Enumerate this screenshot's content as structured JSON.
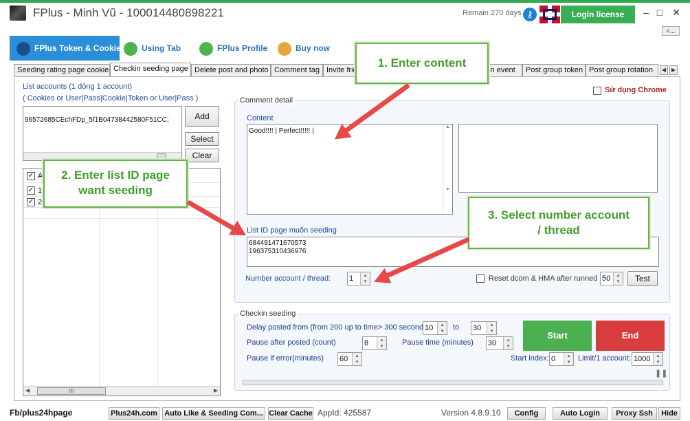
{
  "titlebar": {
    "title": "FPlus - Minh Vũ - 100014480898221",
    "remain": "Remain 270 days",
    "login_label": "Login license",
    "minimize": "–",
    "maximize": "□",
    "close": "✕"
  },
  "collapse_label": "<...",
  "main_tabs": [
    {
      "label": "FPlus Token & Cookie",
      "icon": "fplus-token-icon"
    },
    {
      "label": "Using Tab",
      "icon": "link-icon"
    },
    {
      "label": "FPlus Profile",
      "icon": "users-icon"
    },
    {
      "label": "Buy now",
      "icon": "refresh-icon"
    }
  ],
  "sub_tabs": [
    "Seeding rating page cookie",
    "Checkin seeding page",
    "Delete post and photo",
    "Comment tag",
    "Invite frie",
    "oin event",
    "Post group token",
    "Post group rotation"
  ],
  "left": {
    "list_label": "List accounts (1 dòng 1 account)",
    "list_hint": "( Cookies or User|Pass|Cookie|Token or User|Pass )",
    "account_value": "96572685CEchFDp_5f1B04738442580F51CC;",
    "add_label": "Add",
    "select_label": "Select",
    "clear_label": "Clear",
    "rows": [
      "A",
      "1",
      "2"
    ],
    "scroll_thumb": "III"
  },
  "comment": {
    "group_title": "Comment detail",
    "use_chrome_label": "Sử dụng Chrome",
    "content_label": "Content",
    "content_value": "Good!!!! | Perfect!!!!! |",
    "list_id_label": "List ID page muốn seeding",
    "list_ids": [
      "684491471670573",
      "196375310436976"
    ],
    "number_account_label": "Number account / thread:",
    "number_account_value": "1",
    "reset_label": "Reset dcom & HMA after runned",
    "reset_value": "50",
    "test_label": "Test"
  },
  "checkin": {
    "group_title": "Checkin seeding",
    "delay_label": "Delay posted from (from 200 up to time> 300 seconds)",
    "delay_from": "10",
    "to_label": "to",
    "delay_to": "30",
    "pause_after_label": "Pause after posted (count)",
    "pause_after_value": "8",
    "pause_time_label": "Pause time (minutes)",
    "pause_time_value": "30",
    "pause_error_label": "Pause if error(minutes)",
    "pause_error_value": "60",
    "start_index_label": "Start index:",
    "start_index_value": "0",
    "limit_label": "Limit/1 account:",
    "limit_value": "1000",
    "start_label": "Start",
    "end_label": "End"
  },
  "callouts": {
    "c1": "1. Enter content",
    "c2_line1": "2. Enter list ID page",
    "c2_line2": "want seeding",
    "c3_line1": "3. Select number account",
    "c3_line2": "/ thread"
  },
  "status": {
    "page_label": "Fb/plus24hpage",
    "plus24h": "Plus24h.com",
    "auto_like": "Auto Like & Seeding Com...",
    "clear_cache": "Clear Cache",
    "appid": "AppId: 425587",
    "version": "Version 4.8.9.10",
    "config": "Config",
    "auto_login": "Auto Login",
    "proxy": "Proxy Ssh",
    "hide": "Hide"
  },
  "colors": {
    "accent_green": "#3aae55",
    "start_green": "#4caf50",
    "end_red": "#d93c3c",
    "tab_blue": "#2a8fd8",
    "callout_green": "#3f9f2a",
    "arrow_red": "#e84848"
  }
}
